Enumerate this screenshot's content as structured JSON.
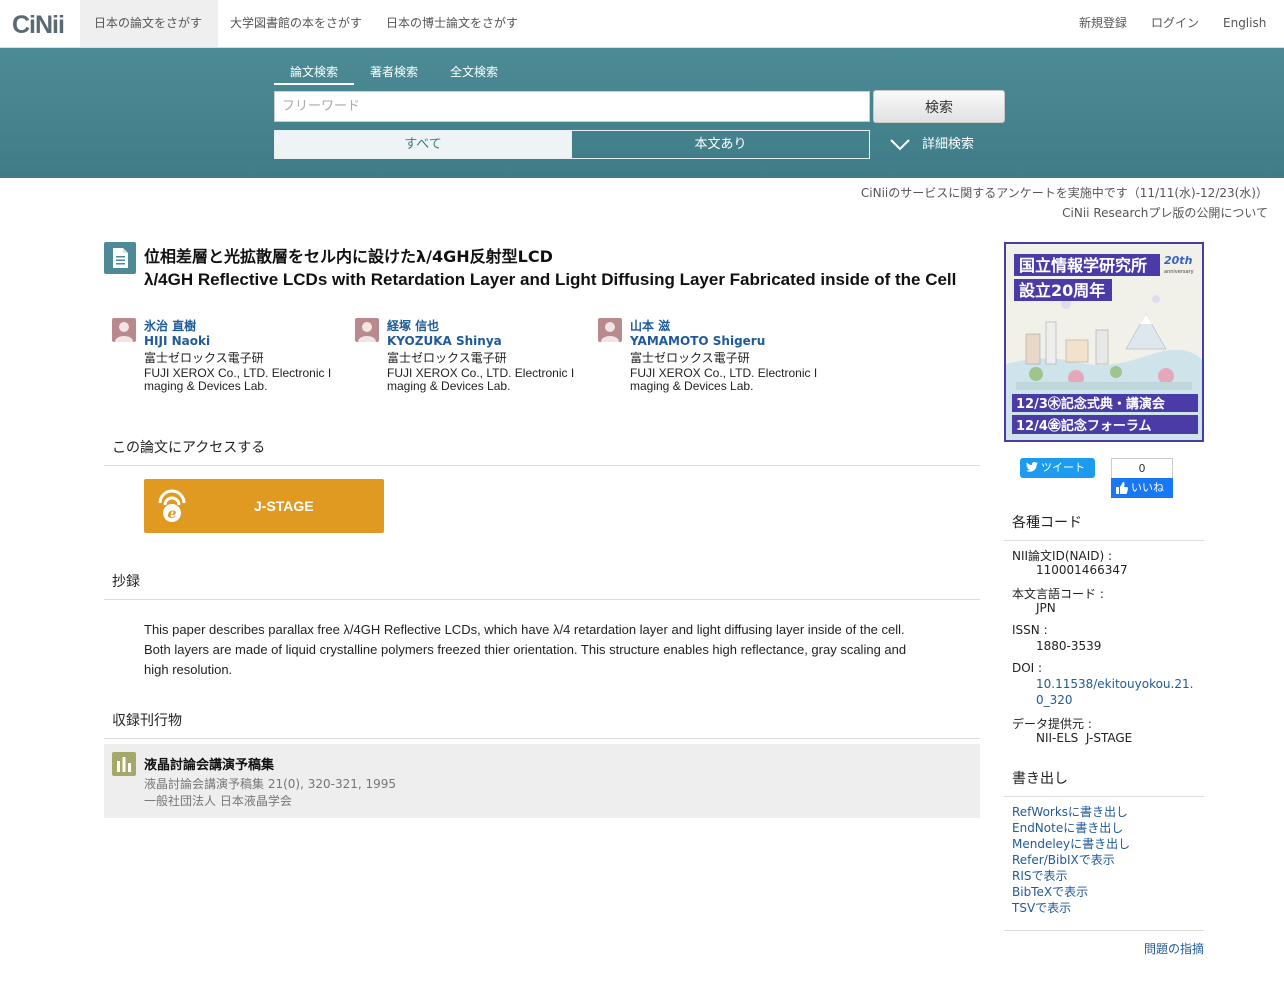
{
  "header": {
    "logo": "CiNii",
    "tabs": [
      "日本の論文をさがす",
      "大学図書館の本をさがす",
      "日本の博士論文をさがす"
    ],
    "links": [
      "新規登録",
      "ログイン",
      "English"
    ]
  },
  "search": {
    "tabs": [
      "論文検索",
      "著者検索",
      "全文検索"
    ],
    "placeholder": "フリーワード",
    "button": "検索",
    "filters": [
      "すべて",
      "本文あり"
    ],
    "advanced": "詳細検索"
  },
  "notices": [
    "CiNiiのサービスに関するアンケートを実施中です（11/11(水)-12/23(水)）",
    "CiNii Researchプレ版の公開について"
  ],
  "article": {
    "title_ja": "位相差層と光拡散層をセル内に設けたλ/4GH反射型LCD",
    "title_en": "λ/4GH Reflective LCDs with Retardation Layer and Light Diffusing Layer Fabricated inside of the Cell",
    "authors": [
      {
        "name_ja": "氷治 直樹",
        "name_en": "HIJI Naoki",
        "aff_ja": "富士ゼロックス電子研",
        "aff_en": "FUJI XEROX Co., LTD. Electronic Imaging & Devices Lab."
      },
      {
        "name_ja": "経塚 信也",
        "name_en": "KYOZUKA Shinya",
        "aff_ja": "富士ゼロックス電子研",
        "aff_en": "FUJI XEROX Co., LTD. Electronic Imaging & Devices Lab."
      },
      {
        "name_ja": "山本 滋",
        "name_en": "YAMAMOTO Shigeru",
        "aff_ja": "富士ゼロックス電子研",
        "aff_en": "FUJI XEROX Co., LTD. Electronic Imaging & Devices Lab."
      }
    ],
    "access_heading": "この論文にアクセスする",
    "jstage_label": "J-STAGE",
    "abstract_heading": "抄録",
    "abstract": "This paper describes parallax free λ/4GH Reflective LCDs, which have λ/4 retardation layer and light diffusing layer inside of the cell. Both layers are made of liquid crystalline polymers freezed thier orientation. This structure enables high reflectance, gray scaling and high resolution.",
    "journal_heading": "収録刊行物",
    "journal_title": "液晶討論会講演予稿集",
    "journal_citation": "液晶討論会講演予稿集 21(0), 320-321, 1995",
    "journal_publisher": "一般社団法人 日本液晶学会"
  },
  "sidebar": {
    "banner": {
      "line1": "国立情報学研究所",
      "line2": "設立20周年",
      "badge": "20th",
      "badge_sub": "anniversary",
      "event1": "12/3㊍記念式典・講演会",
      "event2": "12/4㊎記念フォーラム"
    },
    "tweet": "ツイート",
    "like_count": "0",
    "like": "いいね",
    "codes_heading": "各種コード",
    "codes": [
      {
        "label": "NII論文ID(NAID) :",
        "value": "110001466347"
      },
      {
        "label": "本文言語コード :",
        "value": "JPN"
      },
      {
        "label": "ISSN :",
        "value": "1880-3539"
      },
      {
        "label": "DOI :",
        "value": "10.11538/ekitouyokou.21.0_320"
      },
      {
        "label": "データ提供元 :",
        "value": "NII-ELS  J-STAGE"
      }
    ],
    "export_heading": "書き出し",
    "exports": [
      "RefWorksに書き出し",
      "EndNoteに書き出し",
      "Mendeleyに書き出し",
      "Refer/BibIXで表示",
      "RISで表示",
      "BibTeXで表示",
      "TSVで表示"
    ],
    "report": "問題の指摘"
  }
}
